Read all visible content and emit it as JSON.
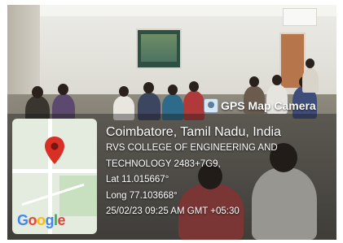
{
  "watermark": {
    "app_title": "GPS Map Camera",
    "app_icon": "camera-app-icon",
    "location": "Coimbatore, Tamil Nadu, India",
    "address_line1": "RVS COLLEGE OF ENGINEERING AND",
    "address_line2": "TECHNOLOGY 2483+7G9,",
    "latitude": "Lat 11.015667°",
    "longitude": "Long 77.103668°",
    "datetime": "25/02/23 09:25 AM GMT +05:30"
  },
  "map": {
    "pin_icon": "location-pin-icon",
    "pin_color": "#d93025",
    "attribution": "Google",
    "attribution_colors": [
      "#4285f4",
      "#ea4335",
      "#fbbc05",
      "#4285f4",
      "#34a853",
      "#ea4335"
    ]
  }
}
